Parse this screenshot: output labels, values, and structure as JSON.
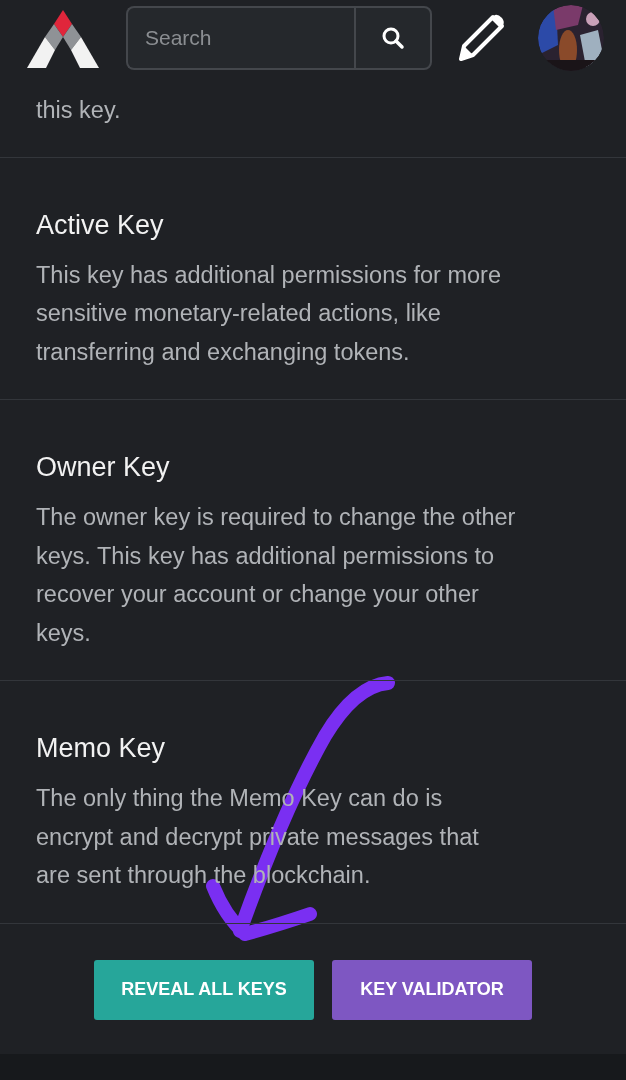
{
  "header": {
    "search": {
      "placeholder": "Search"
    }
  },
  "sections": [
    {
      "description": "this key."
    },
    {
      "title": "Active Key",
      "description": "This key has additional permissions for more sensitive monetary-related actions, like transferring and exchanging tokens."
    },
    {
      "title": "Owner Key",
      "description": "The owner key is required to change the other keys. This key has additional permissions to recover your account or change your other keys."
    },
    {
      "title": "Memo Key",
      "description": "The only thing the Memo Key can do is encrypt and decrypt private messages that are sent through the blockchain."
    }
  ],
  "buttons": [
    {
      "label": "REVEAL ALL KEYS",
      "kind": "reveal"
    },
    {
      "label": "KEY VALIDATOR",
      "kind": "validator"
    }
  ]
}
